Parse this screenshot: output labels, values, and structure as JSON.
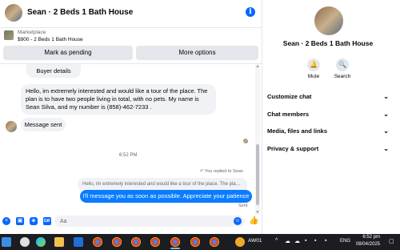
{
  "header": {
    "title": "Sean · 2 Beds 1 Bath House",
    "info_icon": "info-icon",
    "info_glyph": "i"
  },
  "listing": {
    "source": "Marketplace",
    "price_title": "$900 - 2 Beds 1 Bath House",
    "mark_pending_label": "Mark as pending",
    "more_options_label": "More options"
  },
  "messages": {
    "buyer_details_label": "Buyer details",
    "incoming_1": "Hello, im extremely interested and would like a tour of the place. The plan is to have two people living in total, with no pets. My name is Sean Silva, and my number is (858)-462-7233 .",
    "incoming_2": "Message sent",
    "timestamp": "6:52 PM",
    "reply_note": "↶ You replied to Sean",
    "quoted": "Hello, im extremely interested and would like a tour of the place. The place is very nice",
    "outgoing": "I'll message you as soon as possible. Appreciate your patience",
    "status": "Sent"
  },
  "composer": {
    "placeholder": "Aa",
    "icons": [
      "plus-icon",
      "image-icon",
      "sticker-icon",
      "gif-icon",
      "emoji-icon",
      "like-icon"
    ],
    "glyphs": {
      "plus": "+",
      "image": "▣",
      "sticker": "◈",
      "gif": "GIF",
      "emoji": "☺",
      "like": "👍"
    }
  },
  "profile": {
    "name": "Sean · 2 Beds 1 Bath House",
    "mute_label": "Mute",
    "search_label": "Search",
    "mute_glyph": "🔔",
    "search_glyph": "🔍",
    "sections": [
      "Customize chat",
      "Chat members",
      "Media, files and links",
      "Privacy & support"
    ],
    "chevron": "⌄"
  },
  "taskbar": {
    "weather_text": "AW01",
    "language": "ENG",
    "time": "6:52 pm",
    "date": "08/04/2025"
  },
  "colors": {
    "accent": "#0866ff",
    "outgoing_bubble": "#0a7cff",
    "incoming_bubble": "#f0f2f5",
    "button_grey": "#e4e6eb",
    "taskbar": "#1b1d22"
  }
}
